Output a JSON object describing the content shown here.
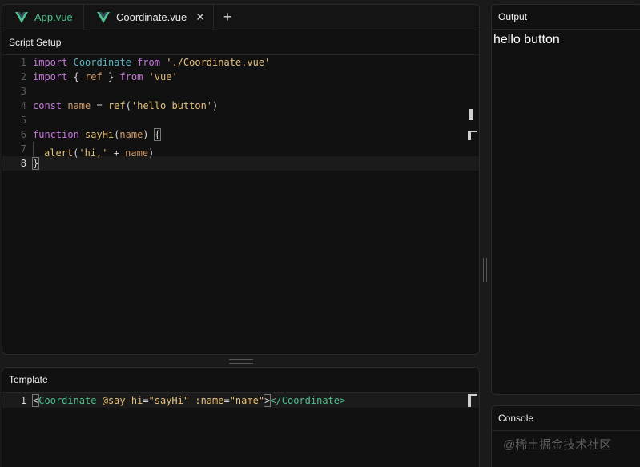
{
  "tabs": [
    {
      "label": "App.vue",
      "active": false
    },
    {
      "label": "Coordinate.vue",
      "active": true
    }
  ],
  "tab_close_glyph": "✕",
  "tab_add_glyph": "+",
  "script_section": {
    "title": "Script Setup"
  },
  "script_lines": [
    {
      "n": "1",
      "tokens": [
        [
          "kw",
          "import"
        ],
        [
          "p",
          " "
        ],
        [
          "ident",
          "Coordinate"
        ],
        [
          "p",
          " "
        ],
        [
          "kw",
          "from"
        ],
        [
          "p",
          " "
        ],
        [
          "str",
          "'./Coordinate.vue'"
        ]
      ]
    },
    {
      "n": "2",
      "tokens": [
        [
          "kw",
          "import"
        ],
        [
          "p",
          " { "
        ],
        [
          "var",
          "ref"
        ],
        [
          "p",
          " } "
        ],
        [
          "kw",
          "from"
        ],
        [
          "p",
          " "
        ],
        [
          "str",
          "'vue'"
        ]
      ]
    },
    {
      "n": "3",
      "tokens": []
    },
    {
      "n": "4",
      "tokens": [
        [
          "kw",
          "const"
        ],
        [
          "p",
          " "
        ],
        [
          "var",
          "name"
        ],
        [
          "p",
          " = "
        ],
        [
          "fn",
          "ref"
        ],
        [
          "p",
          "("
        ],
        [
          "str",
          "'hello button'"
        ],
        [
          "p",
          ")"
        ]
      ]
    },
    {
      "n": "5",
      "tokens": []
    },
    {
      "n": "6",
      "tokens": [
        [
          "kw",
          "function"
        ],
        [
          "p",
          " "
        ],
        [
          "fn",
          "sayHi"
        ],
        [
          "p",
          "("
        ],
        [
          "var",
          "name"
        ],
        [
          "p",
          ") "
        ],
        [
          "brk",
          "{"
        ]
      ]
    },
    {
      "n": "7",
      "tokens": [
        [
          "guide",
          ""
        ],
        [
          "fn",
          "alert"
        ],
        [
          "p",
          "("
        ],
        [
          "str",
          "'hi,'"
        ],
        [
          "p",
          " + "
        ],
        [
          "var",
          "name"
        ],
        [
          "p",
          ")"
        ]
      ]
    },
    {
      "n": "8",
      "tokens": [
        [
          "brk",
          "}"
        ]
      ]
    }
  ],
  "template_section": {
    "title": "Template"
  },
  "template_lines": [
    {
      "n": "1",
      "tokens": [
        [
          "brk",
          "<"
        ],
        [
          "tag",
          "Coordinate"
        ],
        [
          "p",
          " "
        ],
        [
          "attr",
          "@say-hi"
        ],
        [
          "p",
          "="
        ],
        [
          "sv",
          "\"sayHi\""
        ],
        [
          "p",
          " "
        ],
        [
          "attr",
          ":name"
        ],
        [
          "p",
          "="
        ],
        [
          "sv",
          "\"name\""
        ],
        [
          "brk",
          ">"
        ],
        [
          "tag",
          "</Coordinate>"
        ]
      ]
    }
  ],
  "output": {
    "title": "Output",
    "text": "hello button"
  },
  "console": {
    "title": "Console"
  },
  "watermark": "@稀土掘金技术社区",
  "colors": {
    "accent": "#4fc08d",
    "background": "#111111"
  }
}
